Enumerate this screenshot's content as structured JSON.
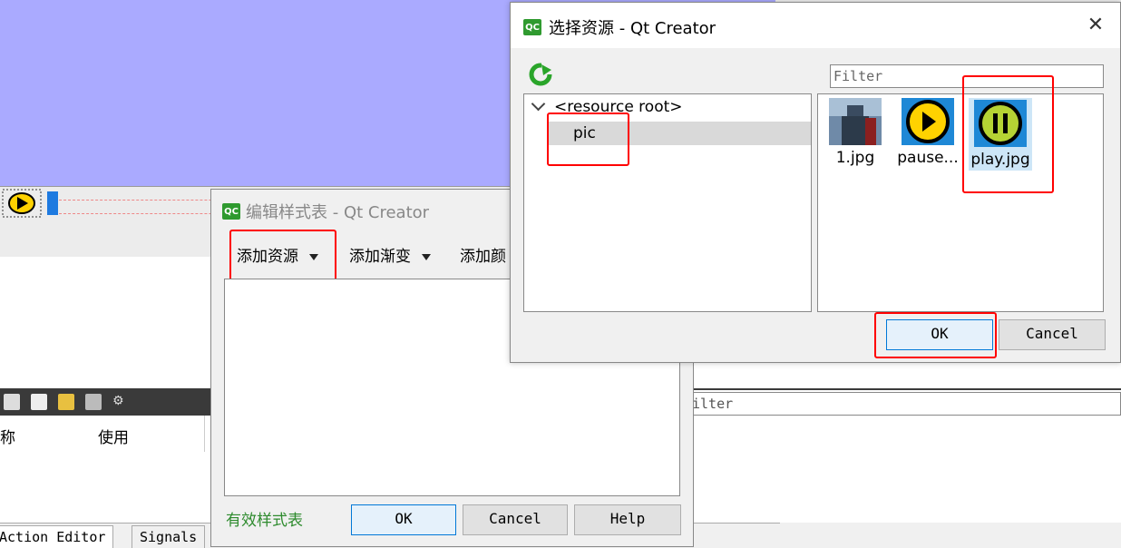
{
  "background": {
    "action_editor": {
      "col_name": "称",
      "col_used": "使用"
    },
    "filter_placeholder": "ilter",
    "tabs": [
      "Action Editor",
      "Signals"
    ]
  },
  "stylesheet_dialog": {
    "title": "编辑样式表 - Qt Creator",
    "menu_add_resource": "添加资源",
    "menu_add_gradient": "添加渐变",
    "menu_add_color": "添加颜",
    "valid_text": "有效样式表",
    "ok": "OK",
    "cancel": "Cancel",
    "help": "Help"
  },
  "resource_dialog": {
    "title": "选择资源 - Qt Creator",
    "close_glyph": "✕",
    "filter_placeholder": "Filter",
    "tree_root": "<resource root>",
    "tree_child": "pic",
    "files": [
      {
        "name": "1.jpg",
        "icon": "thor-thumbnail"
      },
      {
        "name": "pause...",
        "icon": "play-button-thumbnail"
      },
      {
        "name": "play.jpg",
        "icon": "pause-button-thumbnail"
      }
    ],
    "ok": "OK",
    "cancel": "Cancel"
  },
  "qc_icon_text": "QC",
  "colors": {
    "canvas": "#aaaaff",
    "highlight": "#ff0000",
    "valid": "#2e8b2e"
  }
}
